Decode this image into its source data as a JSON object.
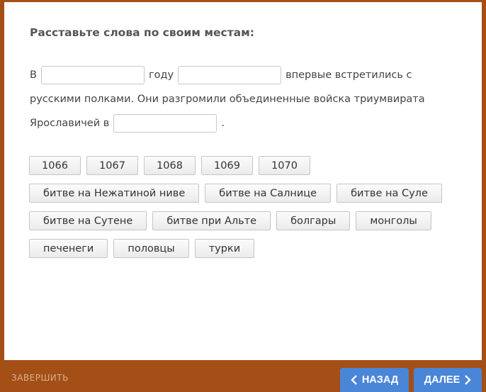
{
  "task": {
    "title": "Расставьте слова по своим местам:",
    "sentence": {
      "part1": "В",
      "part2": "году",
      "part3": "впервые встретились с",
      "line2": "русскими полками. Они разгромили объединенные войска триумвирата",
      "part4": "Ярославичей в",
      "part5": "."
    }
  },
  "options": [
    "1066",
    "1067",
    "1068",
    "1069",
    "1070",
    "битве на Нежатиной ниве",
    "битве на Салнице",
    "битве на Суле",
    "битве на Сутене",
    "битве при Альте",
    "болгары",
    "монголы",
    "печенеги",
    "половцы",
    "турки"
  ],
  "footer": {
    "finish_label": "ЗАВЕРШИТЬ",
    "back_label": "НАЗАД",
    "next_label": "ДАЛЕЕ",
    "back_icon": "chevron-left-icon",
    "next_icon": "chevron-right-icon"
  },
  "colors": {
    "frame": "#a34f16",
    "nav_button": "#4a86d8"
  }
}
